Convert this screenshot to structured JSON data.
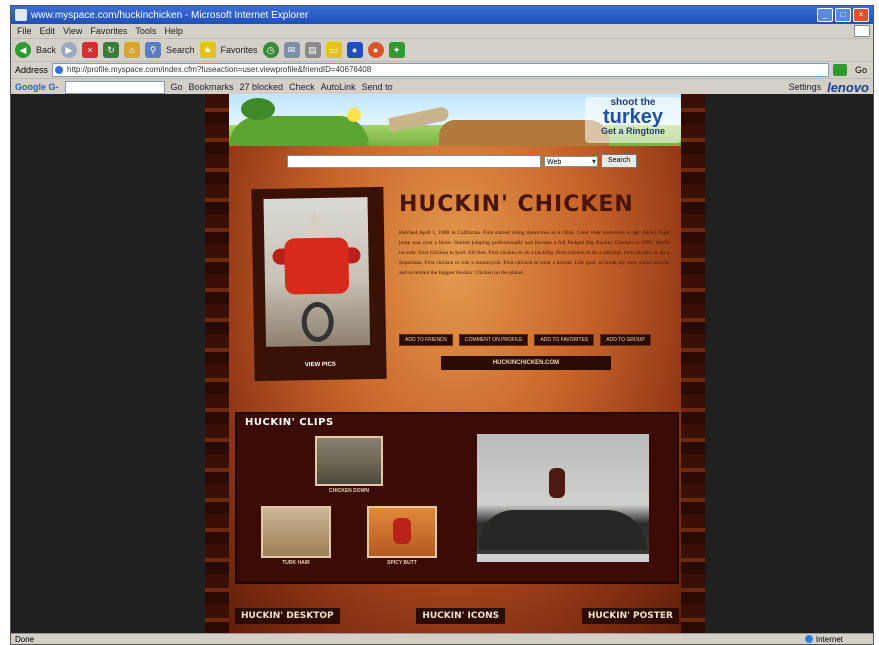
{
  "window": {
    "title": "www.myspace.com/huckinchicken - Microsoft Internet Explorer",
    "buttons": [
      "_",
      "□",
      "×"
    ]
  },
  "menu": [
    "File",
    "Edit",
    "View",
    "Favorites",
    "Tools",
    "Help"
  ],
  "toolbar": {
    "back_label": "Back",
    "search_label": "Search",
    "favorites_label": "Favorites"
  },
  "address": {
    "label": "Address",
    "url": "http://profile.myspace.com/index.cfm?fuseaction=user.viewprofile&friendID=40676408",
    "go_label": "Go"
  },
  "google_bar": {
    "logo": "Google G-",
    "go_label": "Go",
    "bookmarks": "Bookmarks",
    "blocked": "27 blocked",
    "check": "Check",
    "autolink": "AutoLink",
    "send_to": "Send to",
    "settings": "Settings",
    "brand": "lenovo"
  },
  "status": {
    "left": "Done",
    "zone": "Internet"
  },
  "page": {
    "ad": {
      "shoot_the": "shoot the",
      "turkey": "turkey",
      "ringtone": "Get a Ringtone"
    },
    "search": {
      "scope": "Web",
      "button": "Search"
    },
    "photo_caption": "VIEW PICS",
    "title": "HUCKIN' CHICKEN",
    "bio": "Hatched April 1, 1988 in California. First started riding motocross as a chick. Later rode motocross to get chicks. First jump was over a fence. Started jumping professionally and became a full fledged Big Buckin' Chicken in 1995. World records: First Chicken to huck 100 feet. First chicken to do a backflip. First chicken to do a tailwhip. First chicken to do a Superman. First chicken to ride a motorcycle. First chicken to wear a helmet. Life goal: to break my own world records and to remain the biggest Huckin' Chicken on the planet.",
    "nav_buttons": [
      "ADD TO FRIENDS",
      "COMMENT ON PROFILE",
      "ADD TO FAVORITES",
      "ADD TO GROUP"
    ],
    "site_button": "HUCKINCHICKEN.COM",
    "clips": {
      "title": "HUCKIN' CLIPS",
      "items": [
        {
          "caption": "CHICKEN DOWN"
        },
        {
          "caption": "TURK HAIR"
        },
        {
          "caption": "SPICY BUTT"
        }
      ]
    },
    "bottom_links": [
      "HUCKIN' DESKTOP",
      "HUCKIN' ICONS",
      "HUCKIN' POSTER"
    ]
  }
}
